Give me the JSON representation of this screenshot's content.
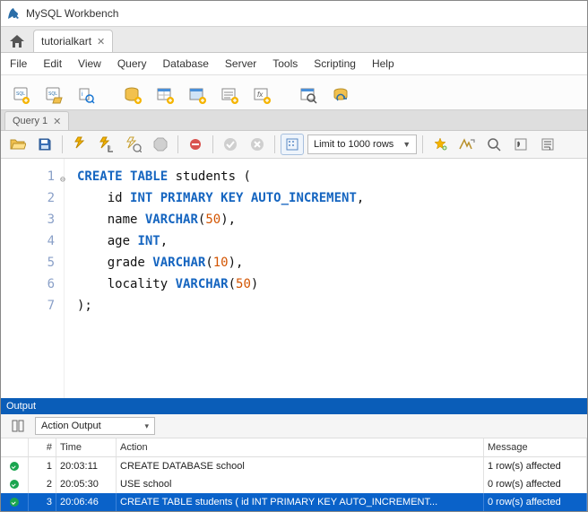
{
  "window": {
    "title": "MySQL Workbench"
  },
  "connection_tab": {
    "label": "tutorialkart"
  },
  "menu": {
    "file": "File",
    "edit": "Edit",
    "view": "View",
    "query": "Query",
    "database": "Database",
    "server": "Server",
    "tools": "Tools",
    "scripting": "Scripting",
    "help": "Help"
  },
  "sql_tab": {
    "label": "Query 1"
  },
  "limit": {
    "label": "Limit to 1000 rows"
  },
  "code": {
    "lines": [
      "1",
      "2",
      "3",
      "4",
      "5",
      "6",
      "7"
    ],
    "l1_kw1": "CREATE",
    "l1_kw2": "TABLE",
    "l1_id": "students",
    "l1_p": " (",
    "l2_id": "id ",
    "l2_tp": "INT PRIMARY KEY AUTO_INCREMENT",
    "l2_p": ",",
    "l3_id": "name ",
    "l3_tp": "VARCHAR",
    "l3_p1": "(",
    "l3_n": "50",
    "l3_p2": "),",
    "l4_id": "age ",
    "l4_tp": "INT",
    "l4_p": ",",
    "l5_id": "grade ",
    "l5_tp": "VARCHAR",
    "l5_p1": "(",
    "l5_n": "10",
    "l5_p2": "),",
    "l6_id": "locality ",
    "l6_tp": "VARCHAR",
    "l6_p1": "(",
    "l6_n": "50",
    "l6_p2": ")",
    "l7": ");"
  },
  "output": {
    "title": "Output",
    "combo": "Action Output",
    "headers": {
      "n": "#",
      "time": "Time",
      "action": "Action",
      "message": "Message"
    },
    "rows": [
      {
        "n": "1",
        "time": "20:03:11",
        "action": "CREATE DATABASE school",
        "message": "1 row(s) affected"
      },
      {
        "n": "2",
        "time": "20:05:30",
        "action": "USE school",
        "message": "0 row(s) affected"
      },
      {
        "n": "3",
        "time": "20:06:46",
        "action": "CREATE TABLE students (     id INT PRIMARY KEY AUTO_INCREMENT...",
        "message": "0 row(s) affected"
      }
    ]
  }
}
